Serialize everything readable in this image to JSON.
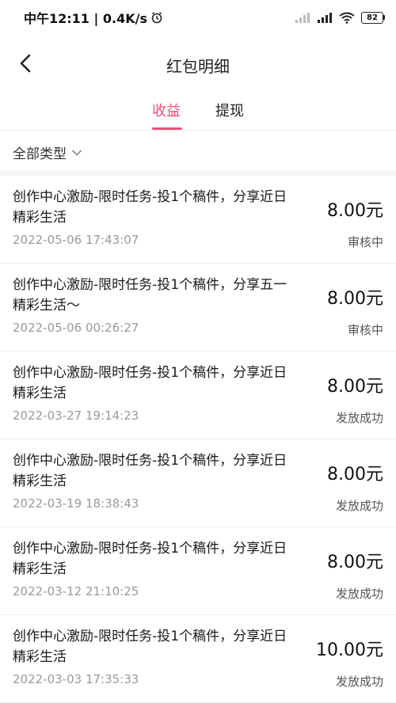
{
  "status_bar": {
    "time_speed": "中午12:11 | 0.4K/s",
    "battery": "82"
  },
  "nav": {
    "title": "红包明细"
  },
  "tabs": [
    {
      "label": "收益"
    },
    {
      "label": "提现"
    }
  ],
  "filter": {
    "label": "全部类型"
  },
  "records": [
    {
      "title": "创作中心激励-限时任务-投1个稿件，分享近日精彩生活",
      "time": "2022-05-06 17:43:07",
      "amount": "8.00元",
      "status": "审核中"
    },
    {
      "title": "创作中心激励-限时任务-投1个稿件，分享五一精彩生活～",
      "time": "2022-05-06 00:26:27",
      "amount": "8.00元",
      "status": "审核中"
    },
    {
      "title": "创作中心激励-限时任务-投1个稿件，分享近日精彩生活",
      "time": "2022-03-27 19:14:23",
      "amount": "8.00元",
      "status": "发放成功"
    },
    {
      "title": "创作中心激励-限时任务-投1个稿件，分享近日精彩生活",
      "time": "2022-03-19 18:38:43",
      "amount": "8.00元",
      "status": "发放成功"
    },
    {
      "title": "创作中心激励-限时任务-投1个稿件，分享近日精彩生活",
      "time": "2022-03-12 21:10:25",
      "amount": "8.00元",
      "status": "发放成功"
    },
    {
      "title": "创作中心激励-限时任务-投1个稿件，分享近日精彩生活",
      "time": "2022-03-03 17:35:33",
      "amount": "10.00元",
      "status": "发放成功"
    }
  ],
  "colors": {
    "accent": "#e8517a"
  }
}
